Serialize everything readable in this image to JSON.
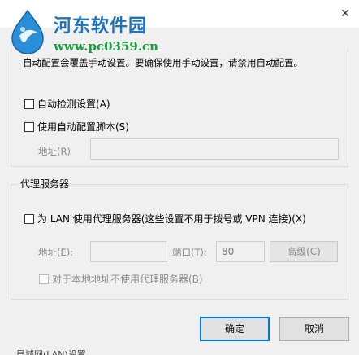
{
  "window": {
    "close_glyph": "✕"
  },
  "watermark": {
    "title": "河东软件园",
    "url": "www.pc0359.cn",
    "logo_icon": "water-drop-logo-icon",
    "colors": {
      "title": "#1e73be",
      "url": "#1a9e3a"
    }
  },
  "notice": "自动配置会覆盖手动设置。要确保使用手动设置，请禁用自动配置。",
  "auto_config": {
    "auto_detect_label": "自动检测设置(A)",
    "auto_detect_checked": false,
    "use_script_label": "使用自动配置脚本(S)",
    "use_script_checked": false,
    "address_label": "地址(R)",
    "address_value": ""
  },
  "proxy": {
    "group_label": "代理服务器",
    "use_proxy_label": "为 LAN 使用代理服务器(这些设置不用于拨号或 VPN 连接)(X)",
    "use_proxy_checked": false,
    "address_label": "地址(E):",
    "address_value": "",
    "port_label": "端口(T):",
    "port_value": "80",
    "advanced_label": "高级(C)",
    "bypass_local_label": "对于本地地址不使用代理服务器(B)",
    "bypass_local_checked": false
  },
  "buttons": {
    "ok": "确定",
    "cancel": "取消"
  },
  "background_text": "局域网(LAN)设置"
}
